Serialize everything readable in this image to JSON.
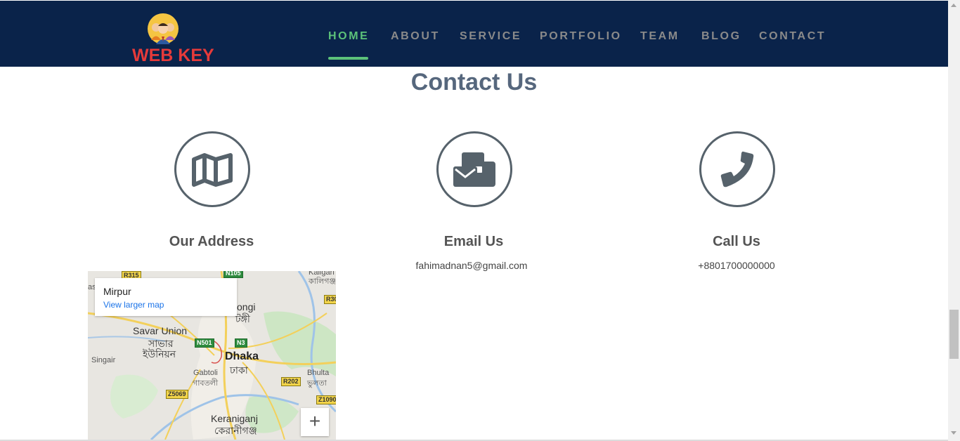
{
  "brand": {
    "name": "WEB KEY",
    "logo": "team-avatars-logo"
  },
  "nav": {
    "items": [
      {
        "label": "HOME",
        "active": true
      },
      {
        "label": "ABOUT",
        "active": false
      },
      {
        "label": "SERVICE",
        "active": false
      },
      {
        "label": "PORTFOLIO",
        "active": false
      },
      {
        "label": "TEAM",
        "active": false
      },
      {
        "label": "BLOG",
        "active": false
      },
      {
        "label": "CONTACT",
        "active": false
      }
    ]
  },
  "contact": {
    "title": "Contact Us",
    "cards": [
      {
        "icon": "map-icon",
        "title": "Our Address",
        "value": ""
      },
      {
        "icon": "envelope-icon",
        "title": "Email Us",
        "value": "fahimadnan5@gmail.com"
      },
      {
        "icon": "phone-icon",
        "title": "Call Us",
        "value": "+8801700000000"
      }
    ]
  },
  "map": {
    "place_name": "Mirpur",
    "larger_map_link": "View larger map",
    "zoom_in": "+",
    "labels": {
      "tongi": "ongi",
      "tongi_bn": "টঙ্গী",
      "savar": "Savar Union",
      "savar_bn1": "সাভার",
      "savar_bn2": "ইউনিয়ন",
      "singair": "Singair",
      "dhaka": "Dhaka",
      "dhaka_bn": "ঢাকা",
      "gabtoli": "Gabtoli",
      "gabtoli_bn": "গাবতলী",
      "bhulta": "Bhulta",
      "bhulta_bn": "ভুলতা",
      "keraniganj": "Keraniganj",
      "keraniganj_bn": "কেরানীগঞ্জ",
      "kaliganj": "Kaligan",
      "kaliganj_bn": "কালিগঞ্জ",
      "edge_as": "as"
    },
    "shields": {
      "r315": "R315",
      "n105": "N105",
      "r30": "R30",
      "n501": "N501",
      "n3": "N3",
      "r202": "R202",
      "z5069": "Z5069",
      "z1090": "Z1090"
    }
  },
  "colors": {
    "navbar_bg": "#0a234a",
    "brand_red": "#e63a3a",
    "nav_active": "#5cc27a",
    "nav_inactive": "#8a8a8a",
    "title": "#56677d",
    "icon": "#56626b"
  }
}
